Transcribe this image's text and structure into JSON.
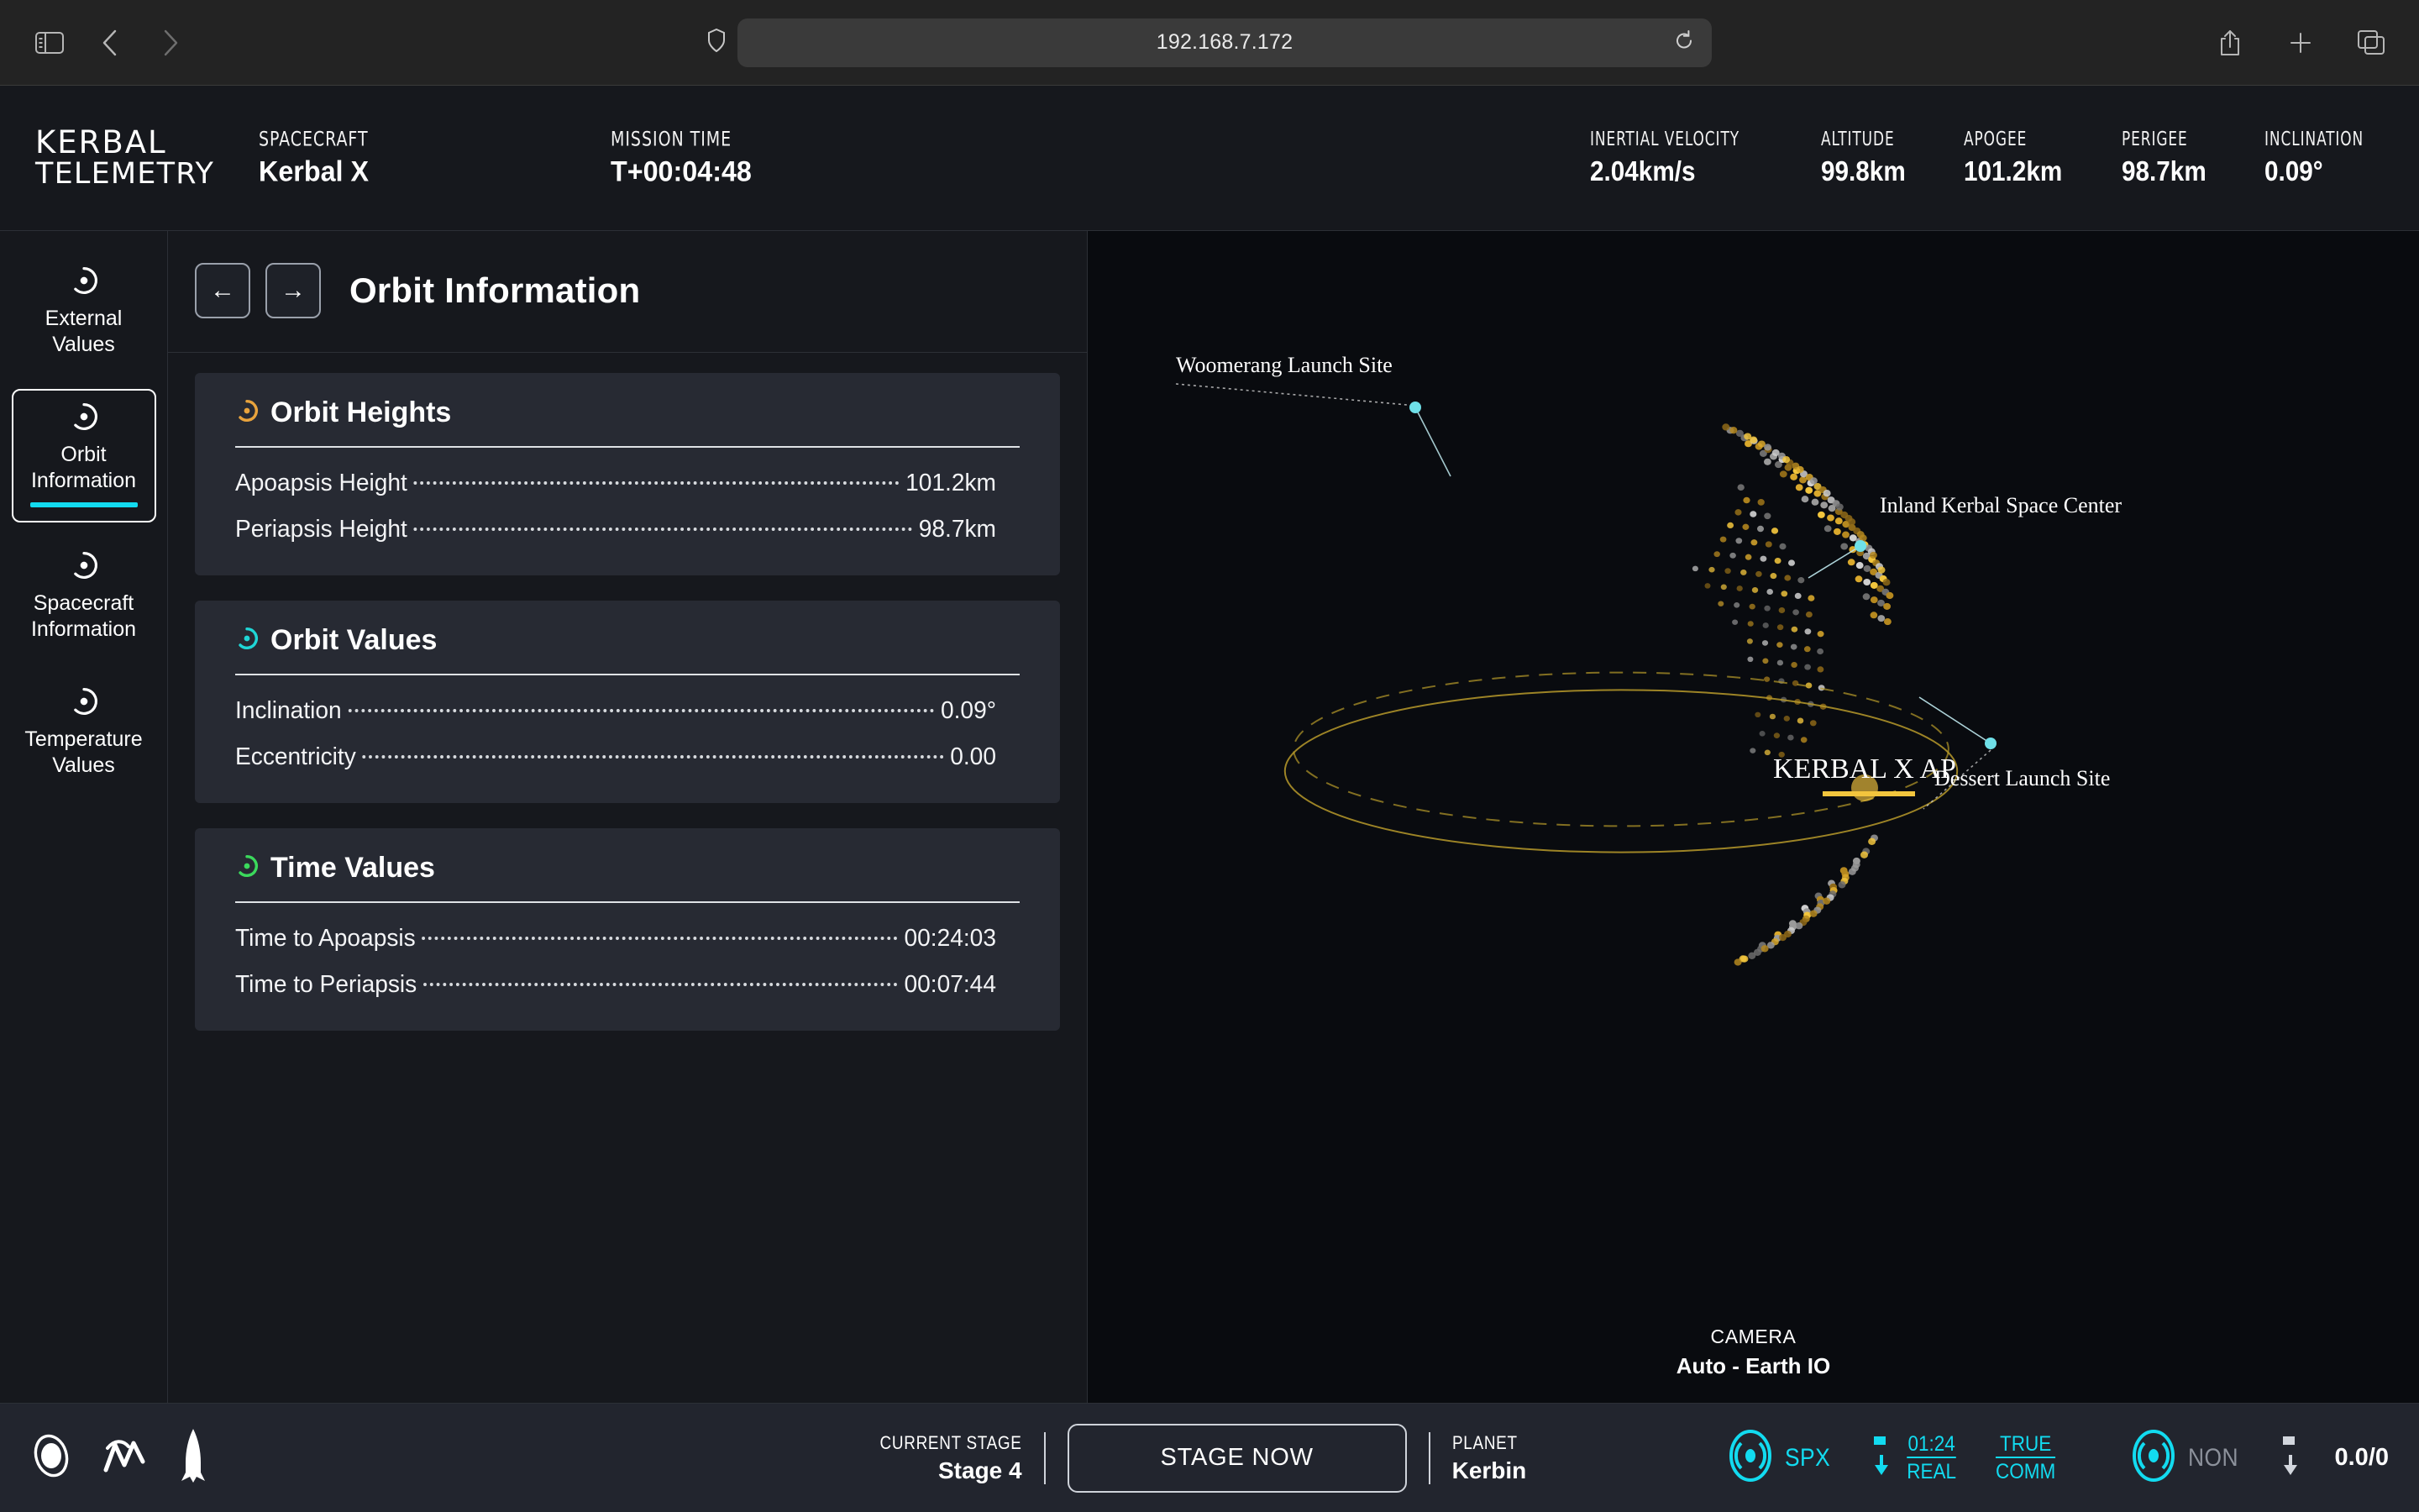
{
  "browser": {
    "url": "192.168.7.172",
    "icons": {
      "sidebar": "sidebar-toggle-icon",
      "back": "back-chevron-icon",
      "forward": "forward-chevron-icon",
      "shield": "privacy-shield-icon",
      "reload": "reload-icon",
      "share": "share-icon",
      "newtab": "new-tab-icon",
      "tabs": "tab-overview-icon"
    }
  },
  "header": {
    "logo_line1": "KERBAL",
    "logo_line2": "TELEMETRY",
    "spacecraft_label": "SPACECRAFT",
    "spacecraft_value": "Kerbal X",
    "mission_label": "MISSION TIME",
    "mission_value": "T+00:04:48",
    "stats": [
      {
        "label": "INERTIAL VELOCITY",
        "value": "2.04km/s"
      },
      {
        "label": "ALTITUDE",
        "value": "99.8km"
      },
      {
        "label": "APOGEE",
        "value": "101.2km"
      },
      {
        "label": "PERIGEE",
        "value": "98.7km"
      },
      {
        "label": "INCLINATION",
        "value": "0.09°"
      }
    ]
  },
  "sidebar": {
    "items": [
      {
        "label": "External\nValues",
        "line1": "External",
        "line2": "Values",
        "active": false
      },
      {
        "label": "Orbit Information",
        "line1": "Orbit",
        "line2": "Information",
        "active": true
      },
      {
        "label": "Spacecraft Information",
        "line1": "Spacecraft",
        "line2": "Information",
        "active": false
      },
      {
        "label": "Temperature Values",
        "line1": "Temperature",
        "line2": "Values",
        "active": false
      }
    ],
    "accent": "#12dbf0"
  },
  "panel": {
    "title": "Orbit Information",
    "back_arrow": "←",
    "forward_arrow": "→",
    "cards": [
      {
        "title": "Orbit Heights",
        "icon_color": "#e8a33d",
        "rows": [
          {
            "label": "Apoapsis Height",
            "value": "101.2km"
          },
          {
            "label": "Periapsis Height",
            "value": "98.7km"
          }
        ]
      },
      {
        "title": "Orbit Values",
        "icon_color": "#1fd6d6",
        "rows": [
          {
            "label": "Inclination",
            "value": "0.09°"
          },
          {
            "label": "Eccentricity",
            "value": "0.00"
          }
        ]
      },
      {
        "title": "Time Values",
        "icon_color": "#3bd95c",
        "rows": [
          {
            "label": "Time to Apoapsis",
            "value": "00:24:03"
          },
          {
            "label": "Time to Periapsis",
            "value": "00:07:44"
          }
        ]
      }
    ]
  },
  "globe": {
    "markers": [
      {
        "name": "Woomerang Launch Site"
      },
      {
        "name": "Inland Kerbal Space Center"
      },
      {
        "name": "Dessert Launch Site"
      }
    ],
    "apoapsis_label": "KERBAL X AP",
    "camera_label": "CAMERA",
    "camera_value": "Auto - Earth IO",
    "dot_color": "#e3b53a",
    "marker_color": "#6fe0e8"
  },
  "statusbar": {
    "icons": {
      "orbit": "orbit-view-icon",
      "chart": "graph-view-icon",
      "rocket": "rocket-view-icon"
    },
    "stage_label": "CURRENT STAGE",
    "stage_value": "Stage 4",
    "stage_button": "STAGE NOW",
    "planet_label": "PLANET",
    "planet_value": "Kerbin",
    "comm": {
      "primary_tag": "SPX",
      "signal_time": "01:24",
      "signal_mode": "REAL",
      "comm_top": "TRUE",
      "comm_bot": "COMM",
      "secondary_tag": "NON",
      "secondary_value": "0.0/0"
    }
  }
}
